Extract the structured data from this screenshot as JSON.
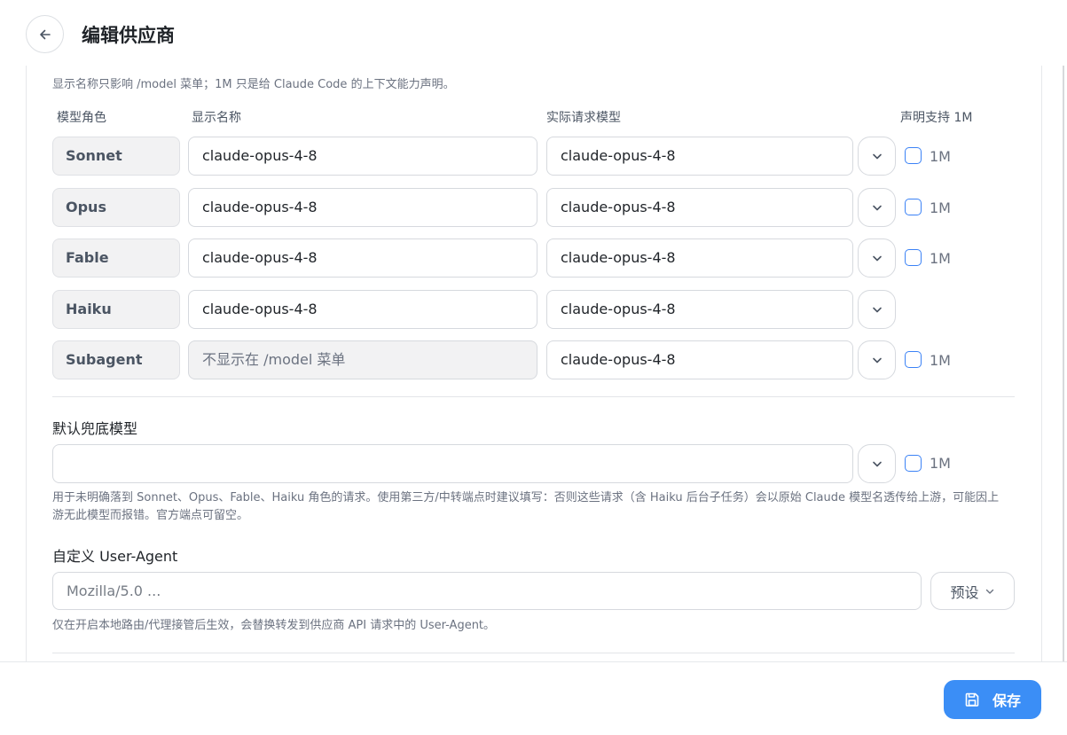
{
  "header": {
    "title": "编辑供应商",
    "back_icon": "arrow-left-icon"
  },
  "models": {
    "hint": "显示名称只影响 /model 菜单；1M 只是给 Claude Code 的上下文能力声明。",
    "columns": {
      "role": "模型角色",
      "display_name": "显示名称",
      "actual_model": "实际请求模型",
      "support_1m": "声明支持 1M"
    },
    "rows": [
      {
        "role": "Sonnet",
        "display_name": "claude-opus-4-8",
        "actual_model": "claude-opus-4-8",
        "has_1m": true,
        "checked": false,
        "label_1m": "1M"
      },
      {
        "role": "Opus",
        "display_name": "claude-opus-4-8",
        "actual_model": "claude-opus-4-8",
        "has_1m": true,
        "checked": false,
        "label_1m": "1M"
      },
      {
        "role": "Fable",
        "display_name": "claude-opus-4-8",
        "actual_model": "claude-opus-4-8",
        "has_1m": true,
        "checked": false,
        "label_1m": "1M"
      },
      {
        "role": "Haiku",
        "display_name": "claude-opus-4-8",
        "actual_model": "claude-opus-4-8",
        "has_1m": false,
        "checked": false,
        "label_1m": ""
      },
      {
        "role": "Subagent",
        "display_name": "不显示在 /model 菜单",
        "actual_model": "claude-opus-4-8",
        "has_1m": true,
        "checked": false,
        "label_1m": "1M",
        "display_disabled": true
      }
    ]
  },
  "fallback": {
    "title": "默认兜底模型",
    "value": "",
    "label_1m": "1M",
    "checked": false,
    "help": "用于未明确落到 Sonnet、Opus、Fable、Haiku 角色的请求。使用第三方/中转端点时建议填写：否则这些请求（含 Haiku 后台子任务）会以原始 Claude 模型名透传给上游，可能因上游无此模型而报错。官方端点可留空。"
  },
  "user_agent": {
    "title": "自定义 User-Agent",
    "placeholder": "Mozilla/5.0 ...",
    "preset_label": "预设",
    "help": "仅在开启本地路由/代理接管后生效，会替换转发到供应商 API 请求中的 User-Agent。"
  },
  "footer": {
    "save_label": "保存",
    "save_icon": "save-icon"
  },
  "colors": {
    "accent": "#3b8ef6",
    "checkbox_border": "#3b82f6",
    "muted_text": "#6b7280"
  }
}
